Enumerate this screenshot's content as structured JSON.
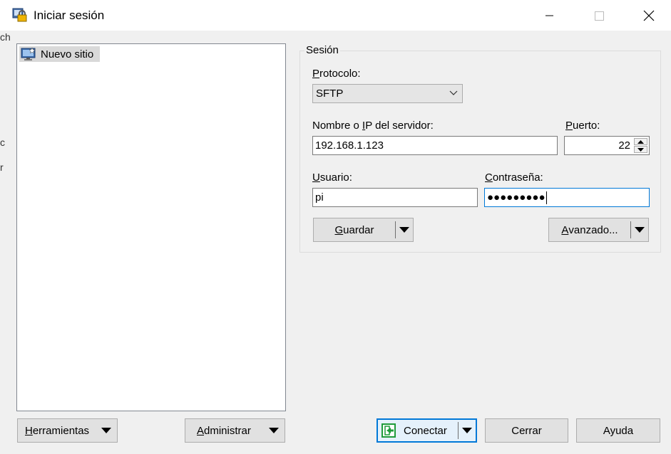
{
  "window": {
    "title": "Iniciar sesión"
  },
  "title_controls": {
    "minimize": "minimize-icon",
    "maximize": "maximize-icon",
    "close": "close-icon"
  },
  "background_fragments": [
    "ch",
    "c",
    "r"
  ],
  "site_tree": {
    "items": [
      {
        "label": "Nuevo sitio",
        "icon": "computer-new-site-icon"
      }
    ]
  },
  "session": {
    "group_title": "Sesión",
    "protocol": {
      "label_pre": "",
      "label_u": "P",
      "label_post": "rotocolo:",
      "value": "SFTP"
    },
    "host": {
      "label_pre": "Nombre o ",
      "label_u": "I",
      "label_post": "P del servidor:",
      "value": "192.168.1.123"
    },
    "port": {
      "label_pre": "",
      "label_u": "P",
      "label_post": "uerto:",
      "value": "22"
    },
    "user": {
      "label_pre": "",
      "label_u": "U",
      "label_post": "suario:",
      "value": "pi"
    },
    "password": {
      "label_pre": "",
      "label_u": "C",
      "label_post": "ontraseña:",
      "masked_value": "●●●●●●●●●"
    },
    "save_button": {
      "pre": "",
      "u": "G",
      "post": "uardar"
    },
    "advanced_button": {
      "pre": "",
      "u": "A",
      "post": "vanzado..."
    }
  },
  "footer": {
    "tools_button": {
      "pre": "",
      "u": "H",
      "post": "erramientas"
    },
    "manage_button": {
      "pre": "",
      "u": "A",
      "post": "dministrar"
    },
    "connect_button": {
      "pre": "",
      "u": "",
      "post": "Conectar"
    },
    "close_button": "Cerrar",
    "help_button": "Ayuda"
  },
  "colors": {
    "accent": "#0078d7",
    "connect_icon": "#1e9b3a"
  }
}
